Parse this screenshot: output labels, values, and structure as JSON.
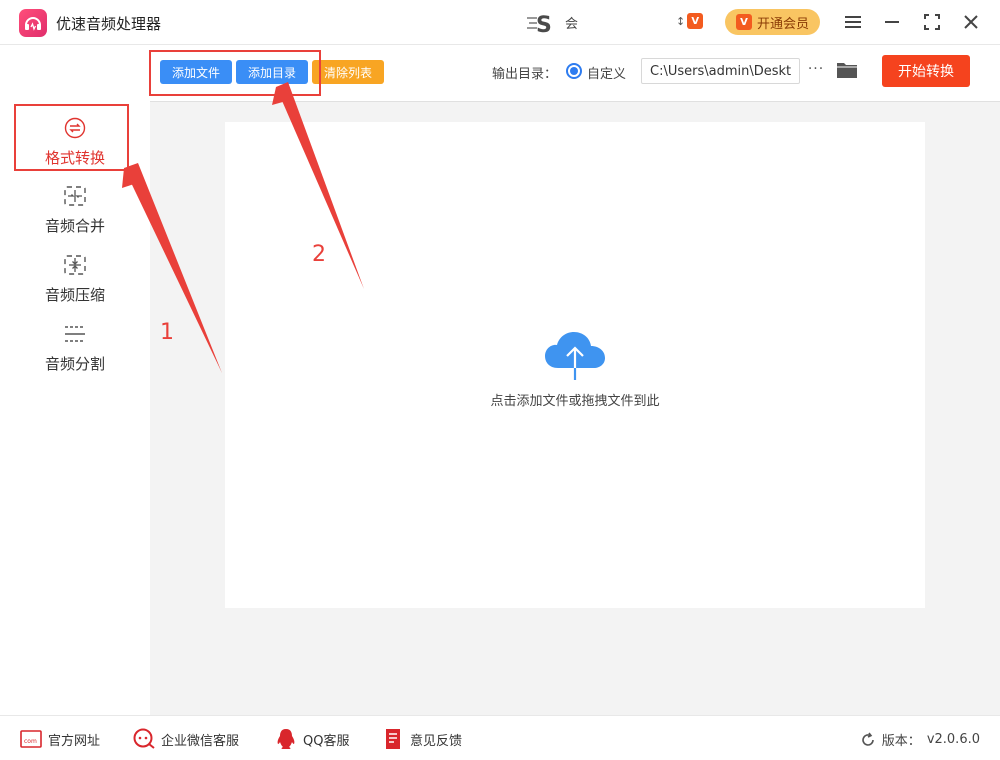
{
  "app": {
    "title": "优速音频处理器"
  },
  "user": {
    "name": "会"
  },
  "vip": {
    "mini_text": "V",
    "button_label": "开通会员"
  },
  "sidebar": {
    "items": [
      {
        "label": "格式转换",
        "icon": "format-convert-icon",
        "active": true
      },
      {
        "label": "音频合并",
        "icon": "merge-icon",
        "active": false
      },
      {
        "label": "音频压缩",
        "icon": "compress-icon",
        "active": false
      },
      {
        "label": "音频分割",
        "icon": "split-icon",
        "active": false
      }
    ]
  },
  "toolbar": {
    "add_file": "添加文件",
    "add_dir": "添加目录",
    "clear_list": "清除列表",
    "output_label": "输出目录：",
    "custom_label": "自定义",
    "path_value": "C:\\Users\\admin\\Desktop",
    "more_label": "···",
    "start_label": "开始转换"
  },
  "dropzone": {
    "text": "点击添加文件或拖拽文件到此"
  },
  "footer": {
    "website": "官方网址",
    "wechat": "企业微信客服",
    "qq": "QQ客服",
    "feedback": "意见反馈",
    "version_label": "版本：",
    "version_value": "v2.0.6.0"
  },
  "annotations": {
    "step1": "1",
    "step2": "2"
  },
  "colors": {
    "accent_red": "#e9403a",
    "primary_blue": "#3a8ef6",
    "orange": "#f8a523",
    "start_red": "#f5431e",
    "vip_gold": "#f9c562"
  }
}
